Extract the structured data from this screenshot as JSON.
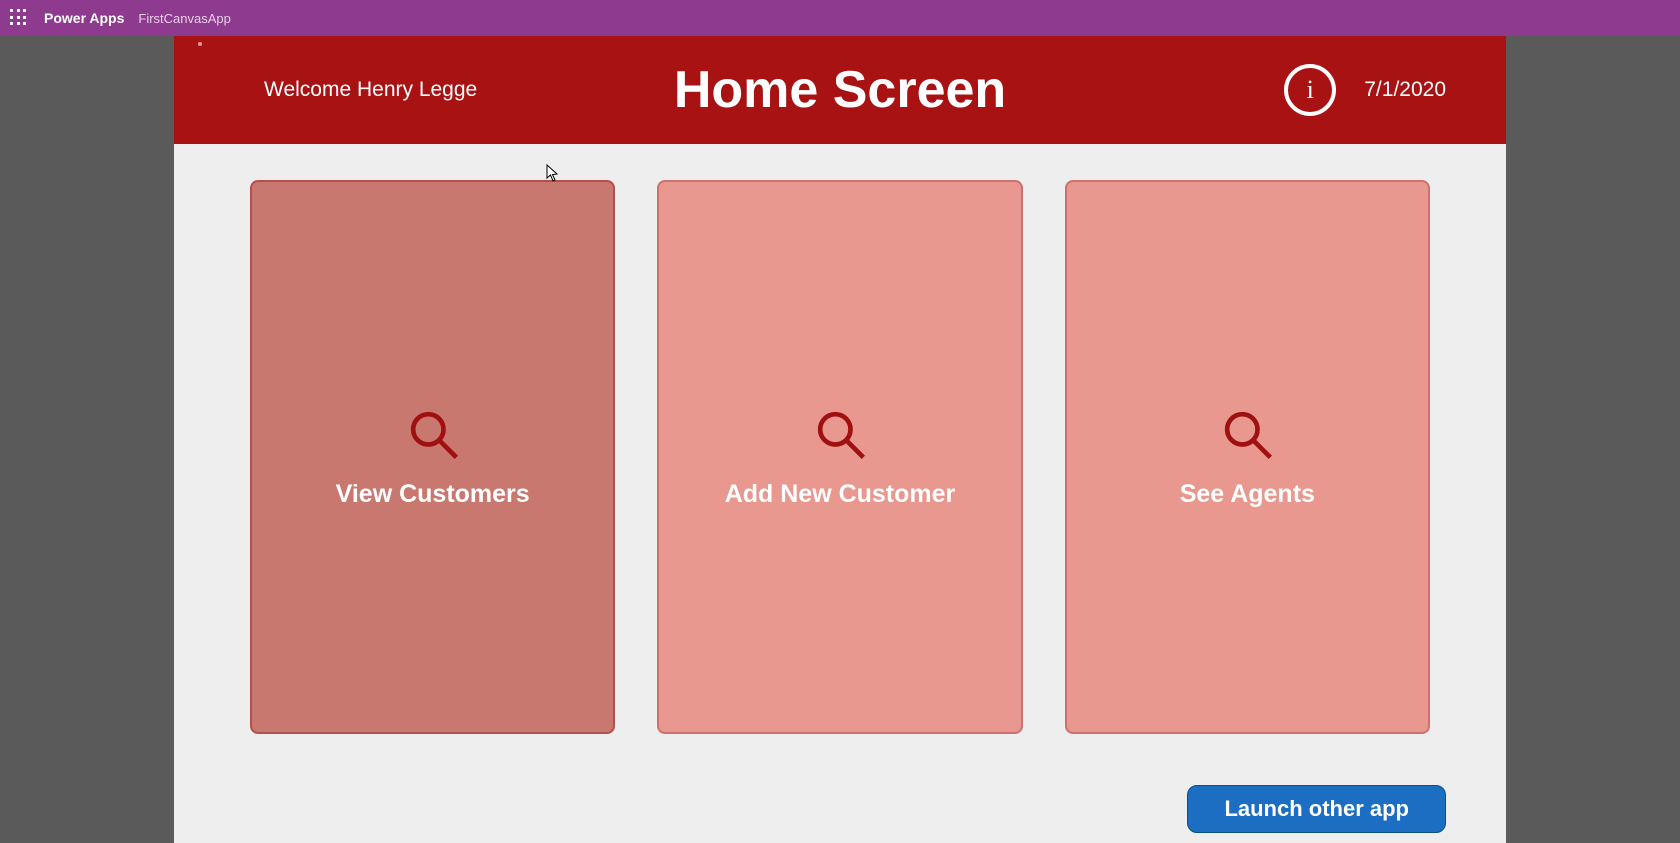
{
  "topbar": {
    "brand": "Power Apps",
    "app_name": "FirstCanvasApp"
  },
  "header": {
    "welcome": "Welcome Henry Legge",
    "title": "Home Screen",
    "info_glyph": "i",
    "date": "7/1/2020"
  },
  "tiles": [
    {
      "label": "View Customers",
      "icon": "search-icon",
      "variant": "primary"
    },
    {
      "label": "Add New Customer",
      "icon": "search-icon",
      "variant": "secondary"
    },
    {
      "label": "See Agents",
      "icon": "search-icon",
      "variant": "secondary"
    }
  ],
  "actions": {
    "launch_label": "Launch other app"
  },
  "colors": {
    "accent_purple": "#8e3a8e",
    "header_red": "#a81212",
    "tile_primary": "#c9786f",
    "tile_secondary": "#e8988e",
    "button_blue": "#1b6ec2"
  }
}
